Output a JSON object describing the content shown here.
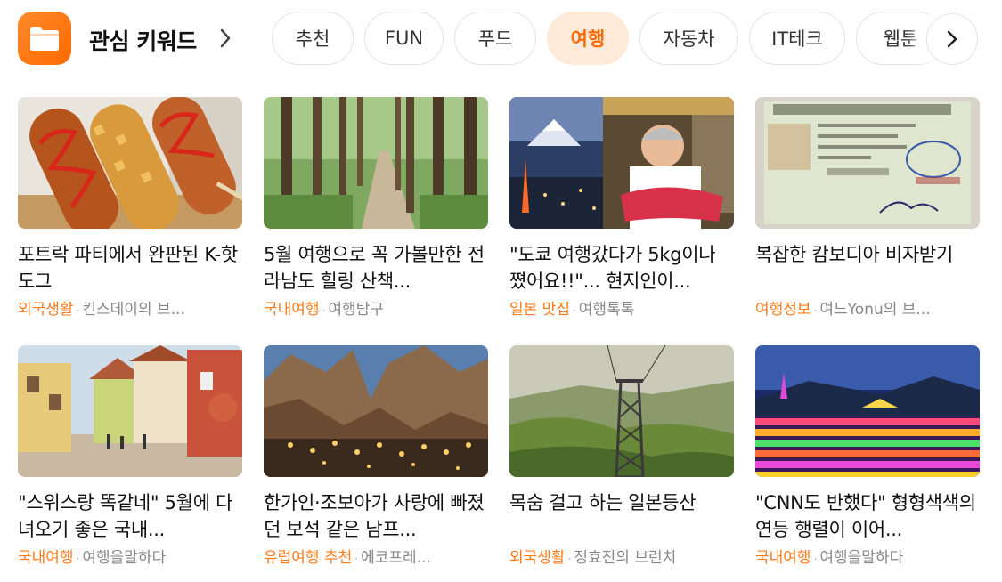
{
  "header": {
    "title": "관심 키워드",
    "tabs": [
      {
        "label": "추천",
        "active": false
      },
      {
        "label": "FUN",
        "active": false
      },
      {
        "label": "푸드",
        "active": false
      },
      {
        "label": "여행",
        "active": true
      },
      {
        "label": "자동차",
        "active": false
      },
      {
        "label": "IT테크",
        "active": false
      },
      {
        "label": "웹툰",
        "active": false
      }
    ]
  },
  "cards": [
    {
      "title": "포트락 파티에서 완판된 K-핫도그",
      "category": "외국생활",
      "source": "킨스데이의 브...",
      "thumb": "hotdog-photo"
    },
    {
      "title": "5월 여행으로 꼭 가볼만한 전라남도 힐링 산책...",
      "category": "국내여행",
      "source": "여행탐구",
      "thumb": "forest-path-photo"
    },
    {
      "title": "\"도쿄 여행갔다가 5kg이나 쪘어요!!\"... 현지인이...",
      "category": "일본 맛집",
      "source": "여행톡톡",
      "thumb": "tokyo-chef-photo"
    },
    {
      "title": "복잡한 캄보디아 비자받기",
      "category": "여행정보",
      "source": "여느Yonu의 브...",
      "thumb": "cambodia-visa-photo"
    },
    {
      "title": "\"스위스랑 똑같네\" 5월에 다녀오기 좋은 국내...",
      "category": "국내여행",
      "source": "여행을말하다",
      "thumb": "swiss-village-photo"
    },
    {
      "title": "한가인·조보아가 사랑에 빠졌던 보석 같은 남프...",
      "category": "유럽여행 추천",
      "source": "에코프레...",
      "thumb": "south-france-village-photo"
    },
    {
      "title": "목숨 걸고 하는 일본등산",
      "category": "외국생활",
      "source": "정효진의 브런치",
      "thumb": "cable-car-mountain-photo"
    },
    {
      "title": "\"CNN도 반했다\" 형형색색의 연등 행렬이 이어...",
      "category": "국내여행",
      "source": "여행을말하다",
      "thumb": "lantern-temple-photo"
    }
  ],
  "colors": {
    "accent": "#ff6a00",
    "active_chip_bg": "#ffe9d9",
    "category": "#ff7a1a"
  }
}
